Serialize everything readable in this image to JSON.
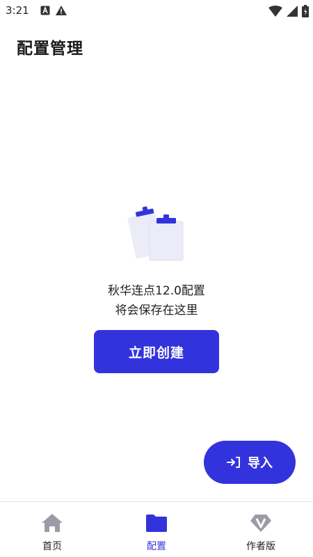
{
  "status_bar": {
    "time": "3:21",
    "left_icons": [
      "text-a-icon",
      "warning-icon"
    ],
    "right_icons": [
      "wifi-icon",
      "signal-icon",
      "battery-icon"
    ]
  },
  "page": {
    "title": "配置管理"
  },
  "empty_state": {
    "illustration": "clipboard-icon",
    "line1": "秋华连点12.0配置",
    "line2": "将会保存在这里",
    "create_label": "立即创建"
  },
  "fab": {
    "icon": "import-icon",
    "label": "导入"
  },
  "bottom_nav": {
    "items": [
      {
        "label": "首页",
        "icon": "home-icon",
        "active": false
      },
      {
        "label": "配置",
        "icon": "folder-icon",
        "active": true
      },
      {
        "label": "作者版",
        "icon": "v-badge-icon",
        "active": false
      }
    ],
    "active_color": "#3333dd",
    "inactive_color": "#9b9ba8"
  },
  "colors": {
    "accent": "#3333dd",
    "background": "#ffffff"
  }
}
